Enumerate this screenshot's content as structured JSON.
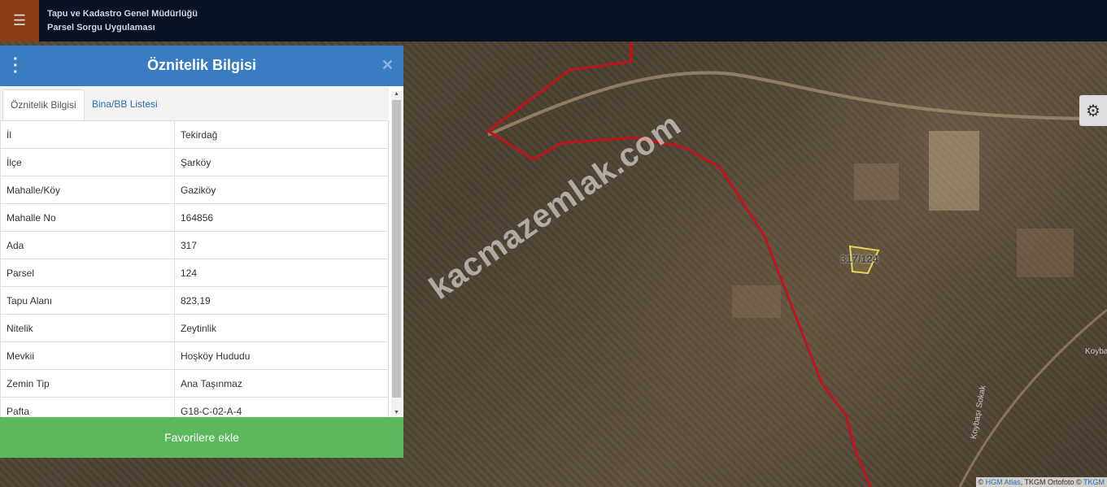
{
  "topbar": {
    "menu_icon": "hamburger-icon",
    "org_name": "Tapu ve Kadastro Genel Müdürlüğü",
    "app_name": "Parsel Sorgu Uygulaması"
  },
  "panel": {
    "title": "Öznitelik Bilgisi",
    "menu_icon": "kebab-icon",
    "close_icon": "close-icon",
    "tabs": [
      {
        "label": "Öznitelik Bilgisi",
        "active": true
      },
      {
        "label": "Bina/BB Listesi",
        "active": false
      }
    ],
    "rows": [
      {
        "key": "İl",
        "value": "Tekirdağ"
      },
      {
        "key": "İlçe",
        "value": "Şarköy"
      },
      {
        "key": "Mahalle/Köy",
        "value": "Gaziköy"
      },
      {
        "key": "Mahalle No",
        "value": "164856"
      },
      {
        "key": "Ada",
        "value": "317"
      },
      {
        "key": "Parsel",
        "value": "124"
      },
      {
        "key": "Tapu Alanı",
        "value": "823,19"
      },
      {
        "key": "Nitelik",
        "value": "Zeytinlik"
      },
      {
        "key": "Mevkii",
        "value": "Hoşköy Hududu"
      },
      {
        "key": "Zemin Tip",
        "value": "Ana Taşınmaz"
      },
      {
        "key": "Pafta",
        "value": "G18-C-02-A-4"
      }
    ],
    "favorite_button": "Favorilere ekle"
  },
  "map": {
    "watermark": "kacmazemlak.com",
    "parcel_label": "317/124",
    "place_label_1": "Koyba",
    "place_label_2": "Koybaşı Sokak",
    "attribution_prefix": "© ",
    "attribution_link_1": "HGM Atlas",
    "attribution_mid": ", TKGM Ortofoto © ",
    "attribution_link_2": "TKGM",
    "settings_icon": "gear-icon",
    "boundary_color": "#c0141a",
    "parcel_color": "#e8d35a"
  }
}
